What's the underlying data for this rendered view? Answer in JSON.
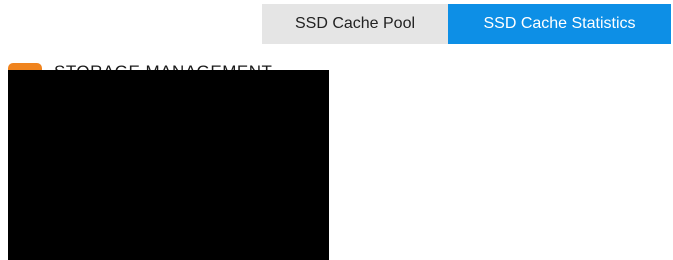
{
  "tabs": {
    "pool_label": "SSD Cache Pool",
    "stats_label": "SSD Cache Statistics"
  },
  "section": {
    "icon": "storage-icon",
    "title": "STORAGE MANAGEMENT"
  },
  "colors": {
    "active_tab": "#0d8fe6",
    "inactive_tab": "#e5e5e5",
    "section_icon": "#f0841e",
    "redaction": "#000000"
  }
}
